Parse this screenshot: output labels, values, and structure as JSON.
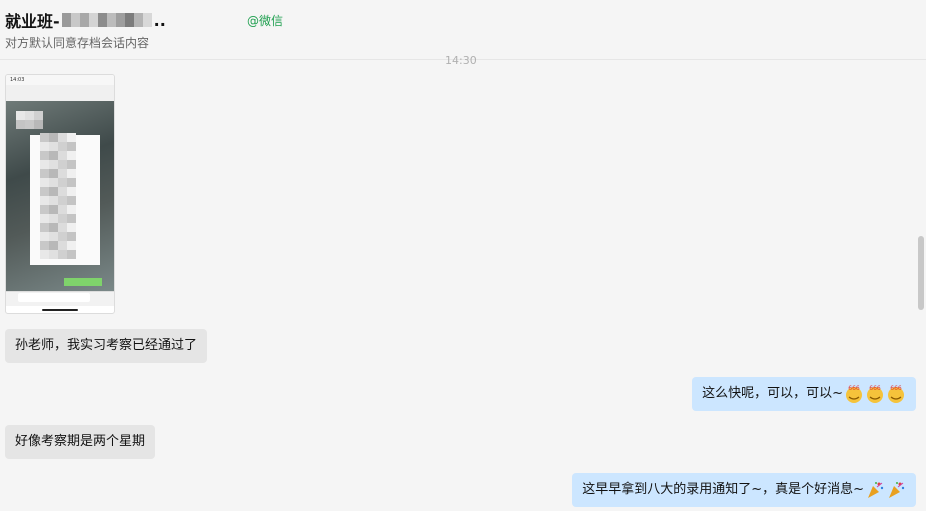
{
  "header": {
    "title_prefix": "就业班-",
    "title_suffix": "..",
    "source_tag": "@微信",
    "subtitle": "对方默认同意存档会话内容"
  },
  "timestamp": "14:30",
  "screenshot_image": {
    "status_time": "14:03",
    "redacted": true
  },
  "messages": [
    {
      "side": "left",
      "text": "孙老师，我实习考察已经通过了"
    },
    {
      "side": "right",
      "text": "这么快呢，可以，可以~",
      "emoji": [
        "666-emoji",
        "666-emoji",
        "666-emoji"
      ]
    },
    {
      "side": "left",
      "text": "好像考察期是两个星期"
    },
    {
      "side": "right",
      "text": "这早早拿到八大的录用通知了~，真是个好消息~",
      "emoji": [
        "party-popper-emoji",
        "party-popper-emoji"
      ]
    }
  ],
  "colors": {
    "left_bubble": "#e5e5e5",
    "right_bubble": "#cce6ff",
    "source_tag": "#20a050"
  }
}
